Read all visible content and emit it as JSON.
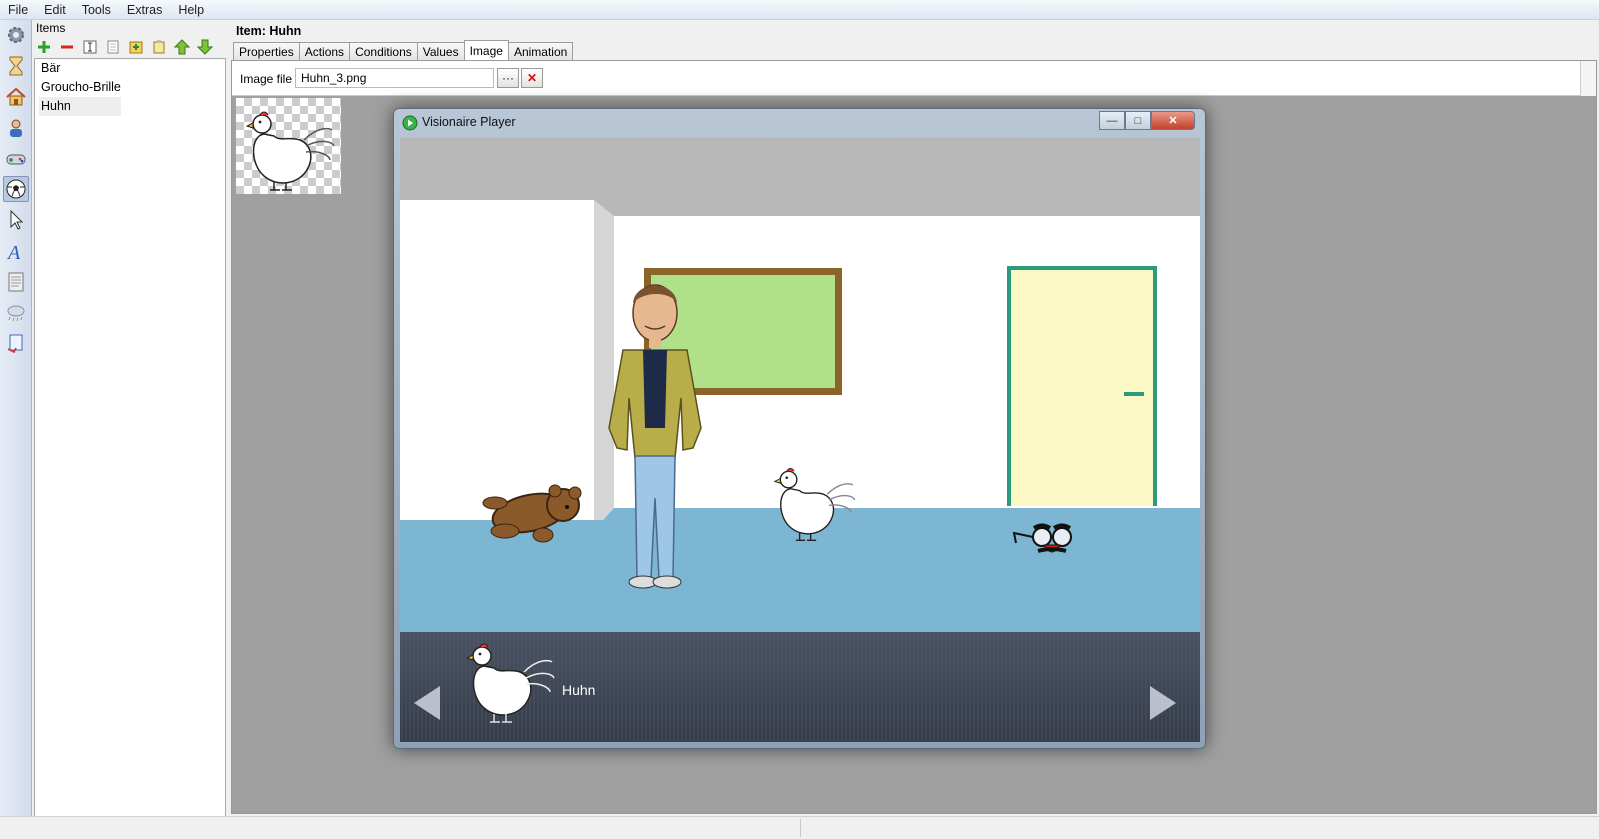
{
  "menu": {
    "items": [
      "File",
      "Edit",
      "Tools",
      "Extras",
      "Help"
    ]
  },
  "sidebar": {
    "icons": [
      "gear-icon",
      "hourglass-icon",
      "home-icon",
      "character-icon",
      "gamepad-icon",
      "ball-icon",
      "pointer-icon",
      "font-icon",
      "text-page-icon",
      "particles-icon",
      "script-icon"
    ],
    "active_index": 5
  },
  "items_panel": {
    "title": "Items",
    "toolbar": [
      "add-icon",
      "remove-icon",
      "rename-icon",
      "copy-icon",
      "paste-icon",
      "clipboard-icon",
      "move-up-icon",
      "move-down-icon"
    ],
    "items": [
      "Bär",
      "Groucho-Brille",
      "Huhn"
    ],
    "selected_index": 2
  },
  "item_editor": {
    "header": "Item: Huhn",
    "tabs": [
      "Properties",
      "Actions",
      "Conditions",
      "Values",
      "Image",
      "Animation"
    ],
    "active_tab": "Image",
    "image_file_label": "Image file",
    "image_file_value": "Huhn_3.png",
    "browse_label": "···",
    "clear_label": "✕"
  },
  "player": {
    "title": "Visionaire Player",
    "controls": {
      "minimize": "—",
      "maximize": "□",
      "close": "✕"
    },
    "inventory_item_label": "Huhn",
    "colors": {
      "floor": "#7cb6d3",
      "board": "#b0e08a",
      "board_frame": "#8a6428",
      "door": "#fbf8c6",
      "door_frame": "#2b9b80"
    }
  }
}
